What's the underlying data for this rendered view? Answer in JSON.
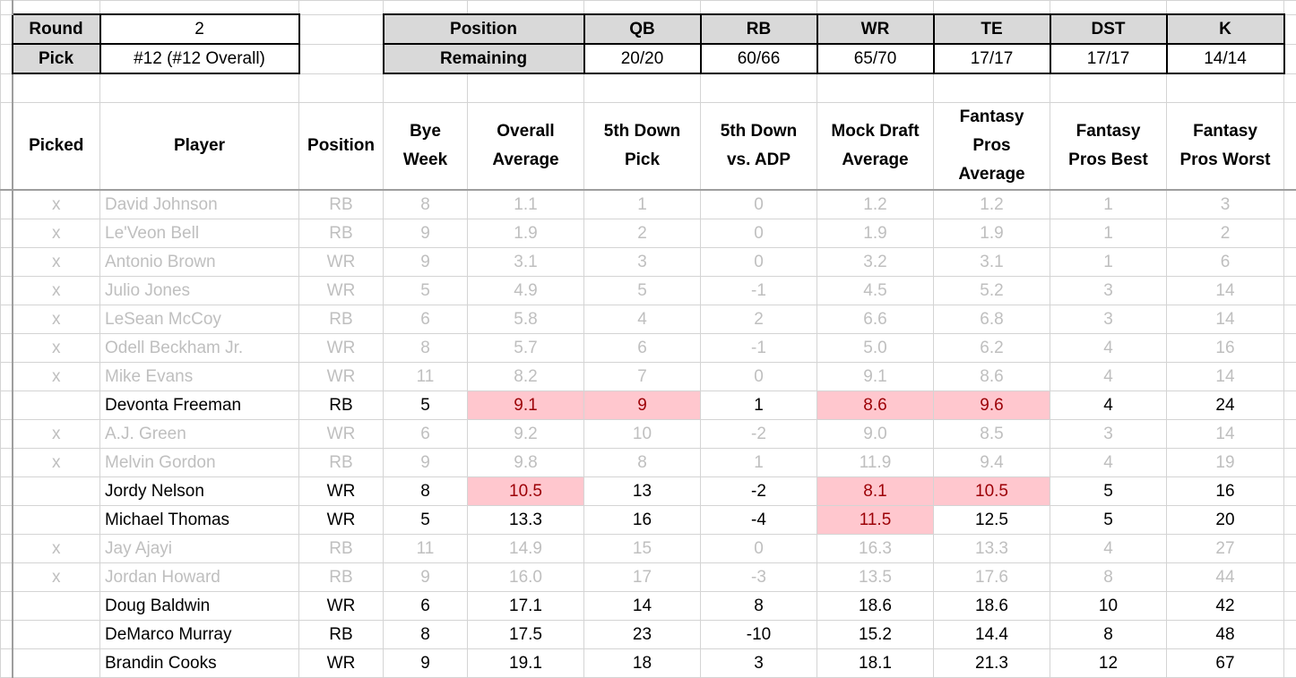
{
  "draft_info": {
    "round_label": "Round",
    "round_value": "2",
    "pick_label": "Pick",
    "pick_value": "#12 (#12 Overall)"
  },
  "positions": {
    "position_label": "Position",
    "remaining_label": "Remaining",
    "items": [
      {
        "pos": "QB",
        "remaining": "20/20"
      },
      {
        "pos": "RB",
        "remaining": "60/66"
      },
      {
        "pos": "WR",
        "remaining": "65/70"
      },
      {
        "pos": "TE",
        "remaining": "17/17"
      },
      {
        "pos": "DST",
        "remaining": "17/17"
      },
      {
        "pos": "K",
        "remaining": "14/14"
      }
    ]
  },
  "columns": {
    "picked": "Picked",
    "name": "Player",
    "position": "Position",
    "bye": "Bye\nWeek",
    "overall_avg": "Overall\nAverage",
    "fifth_down_pick": "5th Down\nPick",
    "fifth_down_vs_adp": "5th Down\nvs. ADP",
    "mock_draft_avg": "Mock Draft\nAverage",
    "fp_avg": "Fantasy\nPros\nAverage",
    "fp_best": "Fantasy\nPros Best",
    "fp_worst": "Fantasy\nPros Worst"
  },
  "players": [
    {
      "picked": "x",
      "name": "David Johnson",
      "position": "RB",
      "bye": "8",
      "overall_avg": "1.1",
      "fifth_down_pick": "1",
      "fifth_down_vs_adp": "0",
      "mock_draft_avg": "1.2",
      "fp_avg": "1.2",
      "fp_best": "1",
      "fp_worst": "3",
      "highlight": []
    },
    {
      "picked": "x",
      "name": "Le'Veon Bell",
      "position": "RB",
      "bye": "9",
      "overall_avg": "1.9",
      "fifth_down_pick": "2",
      "fifth_down_vs_adp": "0",
      "mock_draft_avg": "1.9",
      "fp_avg": "1.9",
      "fp_best": "1",
      "fp_worst": "2",
      "highlight": []
    },
    {
      "picked": "x",
      "name": "Antonio Brown",
      "position": "WR",
      "bye": "9",
      "overall_avg": "3.1",
      "fifth_down_pick": "3",
      "fifth_down_vs_adp": "0",
      "mock_draft_avg": "3.2",
      "fp_avg": "3.1",
      "fp_best": "1",
      "fp_worst": "6",
      "highlight": []
    },
    {
      "picked": "x",
      "name": "Julio Jones",
      "position": "WR",
      "bye": "5",
      "overall_avg": "4.9",
      "fifth_down_pick": "5",
      "fifth_down_vs_adp": "-1",
      "mock_draft_avg": "4.5",
      "fp_avg": "5.2",
      "fp_best": "3",
      "fp_worst": "14",
      "highlight": []
    },
    {
      "picked": "x",
      "name": "LeSean McCoy",
      "position": "RB",
      "bye": "6",
      "overall_avg": "5.8",
      "fifth_down_pick": "4",
      "fifth_down_vs_adp": "2",
      "mock_draft_avg": "6.6",
      "fp_avg": "6.8",
      "fp_best": "3",
      "fp_worst": "14",
      "highlight": []
    },
    {
      "picked": "x",
      "name": "Odell Beckham Jr.",
      "position": "WR",
      "bye": "8",
      "overall_avg": "5.7",
      "fifth_down_pick": "6",
      "fifth_down_vs_adp": "-1",
      "mock_draft_avg": "5.0",
      "fp_avg": "6.2",
      "fp_best": "4",
      "fp_worst": "16",
      "highlight": []
    },
    {
      "picked": "x",
      "name": "Mike Evans",
      "position": "WR",
      "bye": "11",
      "overall_avg": "8.2",
      "fifth_down_pick": "7",
      "fifth_down_vs_adp": "0",
      "mock_draft_avg": "9.1",
      "fp_avg": "8.6",
      "fp_best": "4",
      "fp_worst": "14",
      "highlight": []
    },
    {
      "picked": "",
      "name": "Devonta Freeman",
      "position": "RB",
      "bye": "5",
      "overall_avg": "9.1",
      "fifth_down_pick": "9",
      "fifth_down_vs_adp": "1",
      "mock_draft_avg": "8.6",
      "fp_avg": "9.6",
      "fp_best": "4",
      "fp_worst": "24",
      "highlight": [
        "overall_avg",
        "fifth_down_pick",
        "mock_draft_avg",
        "fp_avg"
      ]
    },
    {
      "picked": "x",
      "name": "A.J. Green",
      "position": "WR",
      "bye": "6",
      "overall_avg": "9.2",
      "fifth_down_pick": "10",
      "fifth_down_vs_adp": "-2",
      "mock_draft_avg": "9.0",
      "fp_avg": "8.5",
      "fp_best": "3",
      "fp_worst": "14",
      "highlight": []
    },
    {
      "picked": "x",
      "name": "Melvin Gordon",
      "position": "RB",
      "bye": "9",
      "overall_avg": "9.8",
      "fifth_down_pick": "8",
      "fifth_down_vs_adp": "1",
      "mock_draft_avg": "11.9",
      "fp_avg": "9.4",
      "fp_best": "4",
      "fp_worst": "19",
      "highlight": []
    },
    {
      "picked": "",
      "name": "Jordy Nelson",
      "position": "WR",
      "bye": "8",
      "overall_avg": "10.5",
      "fifth_down_pick": "13",
      "fifth_down_vs_adp": "-2",
      "mock_draft_avg": "8.1",
      "fp_avg": "10.5",
      "fp_best": "5",
      "fp_worst": "16",
      "highlight": [
        "overall_avg",
        "mock_draft_avg",
        "fp_avg"
      ]
    },
    {
      "picked": "",
      "name": "Michael Thomas",
      "position": "WR",
      "bye": "5",
      "overall_avg": "13.3",
      "fifth_down_pick": "16",
      "fifth_down_vs_adp": "-4",
      "mock_draft_avg": "11.5",
      "fp_avg": "12.5",
      "fp_best": "5",
      "fp_worst": "20",
      "highlight": [
        "mock_draft_avg"
      ]
    },
    {
      "picked": "x",
      "name": "Jay Ajayi",
      "position": "RB",
      "bye": "11",
      "overall_avg": "14.9",
      "fifth_down_pick": "15",
      "fifth_down_vs_adp": "0",
      "mock_draft_avg": "16.3",
      "fp_avg": "13.3",
      "fp_best": "4",
      "fp_worst": "27",
      "highlight": []
    },
    {
      "picked": "x",
      "name": "Jordan Howard",
      "position": "RB",
      "bye": "9",
      "overall_avg": "16.0",
      "fifth_down_pick": "17",
      "fifth_down_vs_adp": "-3",
      "mock_draft_avg": "13.5",
      "fp_avg": "17.6",
      "fp_best": "8",
      "fp_worst": "44",
      "highlight": []
    },
    {
      "picked": "",
      "name": "Doug Baldwin",
      "position": "WR",
      "bye": "6",
      "overall_avg": "17.1",
      "fifth_down_pick": "14",
      "fifth_down_vs_adp": "8",
      "mock_draft_avg": "18.6",
      "fp_avg": "18.6",
      "fp_best": "10",
      "fp_worst": "42",
      "highlight": []
    },
    {
      "picked": "",
      "name": "DeMarco Murray",
      "position": "RB",
      "bye": "8",
      "overall_avg": "17.5",
      "fifth_down_pick": "23",
      "fifth_down_vs_adp": "-10",
      "mock_draft_avg": "15.2",
      "fp_avg": "14.4",
      "fp_best": "8",
      "fp_worst": "48",
      "highlight": []
    },
    {
      "picked": "",
      "name": "Brandin Cooks",
      "position": "WR",
      "bye": "9",
      "overall_avg": "19.1",
      "fifth_down_pick": "18",
      "fifth_down_vs_adp": "3",
      "mock_draft_avg": "18.1",
      "fp_avg": "21.3",
      "fp_best": "12",
      "fp_worst": "67",
      "highlight": []
    }
  ],
  "colors": {
    "highlight_fill": "#FFC7CE",
    "highlight_text": "#9C0006",
    "picked_text": "#BFBFBF",
    "label_fill": "#D9D9D9"
  }
}
